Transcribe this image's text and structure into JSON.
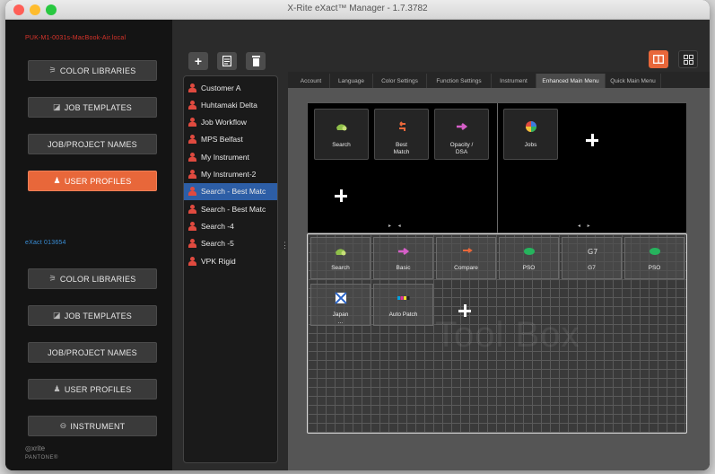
{
  "window": {
    "title": "X-Rite eXact™ Manager - 1.7.3782"
  },
  "sidebar": {
    "device1_name": "PUK-M1-0031s-MacBook-Air.local",
    "device1_items": [
      {
        "label": "COLOR LIBRARIES",
        "icon": "library-icon",
        "glyph": "⚞"
      },
      {
        "label": "JOB TEMPLATES",
        "icon": "template-icon",
        "glyph": "◪"
      },
      {
        "label": "JOB/PROJECT NAMES",
        "icon": "",
        "glyph": ""
      },
      {
        "label": "USER PROFILES",
        "icon": "user-icon",
        "glyph": "♟"
      }
    ],
    "device2_name": "eXact 013654",
    "device2_items": [
      {
        "label": "COLOR LIBRARIES",
        "icon": "library-icon",
        "glyph": "⚞"
      },
      {
        "label": "JOB TEMPLATES",
        "icon": "template-icon",
        "glyph": "◪"
      },
      {
        "label": "JOB/PROJECT NAMES",
        "icon": "",
        "glyph": ""
      },
      {
        "label": "USER PROFILES",
        "icon": "user-icon",
        "glyph": "♟"
      },
      {
        "label": "INSTRUMENT",
        "icon": "instrument-icon",
        "glyph": "⊖"
      }
    ],
    "brand_name": "xrite",
    "brand_sub": "PANTONE®"
  },
  "profiles": [
    "Customer A",
    "Huhtamaki Delta",
    "Job Workflow",
    "MPS Belfast",
    "My Instrument",
    "My Instrument-2",
    "Search - Best Matc",
    "Search - Best Matc",
    "Search -4",
    "Search -5",
    "VPK Rigid"
  ],
  "selected_profile_index": 6,
  "tabs": [
    "Account",
    "Language",
    "Color Settings",
    "Function Settings",
    "Instrument",
    "Enhanced Main Menu",
    "Quick Main Menu"
  ],
  "active_tab_index": 5,
  "main_menu_left": [
    {
      "label": "Search",
      "icon": "search-icon"
    },
    {
      "label": "Best\nMatch",
      "icon": "best-match-icon"
    },
    {
      "label": "Opacity /\nDSA",
      "icon": "opacity-icon"
    }
  ],
  "main_menu_right": [
    {
      "label": "Jobs",
      "icon": "jobs-icon"
    }
  ],
  "toolbox": {
    "watermark": "Tool Box",
    "tiles": [
      {
        "label": "Search",
        "icon": "search-icon"
      },
      {
        "label": "Basic",
        "icon": "basic-icon"
      },
      {
        "label": "Compare",
        "icon": "compare-icon"
      },
      {
        "label": "PSO",
        "icon": "pso-icon"
      },
      {
        "label": "G7",
        "icon": "g7-icon"
      },
      {
        "label": "PSO",
        "icon": "pso-icon"
      },
      {
        "label": "Japan\n...",
        "icon": "japan-icon"
      },
      {
        "label": "Auto Patch",
        "icon": "auto-patch-icon"
      }
    ]
  },
  "colors": {
    "accent": "#e8673a",
    "selection": "#2d5ea6",
    "device1": "#d9342b",
    "device2": "#3a8fd8"
  }
}
